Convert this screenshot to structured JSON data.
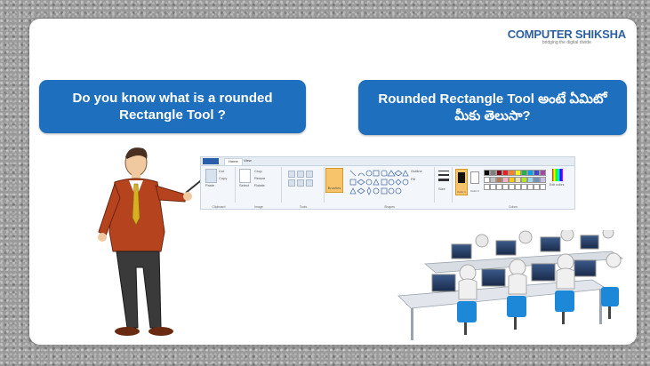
{
  "logo": {
    "name": "COMPUTER SHIKSHA",
    "tagline": "bridging the digital divide"
  },
  "question_en": {
    "line1": "Do you know what is a rounded",
    "line2": "Rectangle Tool ?"
  },
  "question_te": {
    "line1": "Rounded Rectangle Tool అంటే ఏమిటో",
    "line2": "మీకు తెలుసా?"
  },
  "paint_ribbon": {
    "tabs": [
      "Home",
      "View"
    ],
    "groups": [
      "Clipboard",
      "Image",
      "Tools",
      "Shapes",
      "Colors"
    ],
    "buttons": [
      "Paste",
      "Select",
      "Brushes",
      "Size",
      "Color 1",
      "Color 2",
      "Edit colors"
    ],
    "small_buttons": [
      "Cut",
      "Copy",
      "Crop",
      "Resize",
      "Rotate",
      "Outline",
      "Fill"
    ]
  },
  "colors": {
    "bubble": "#1f6fbf",
    "slide_bg": "#ffffff",
    "border_texture": "#9a9a9a"
  }
}
